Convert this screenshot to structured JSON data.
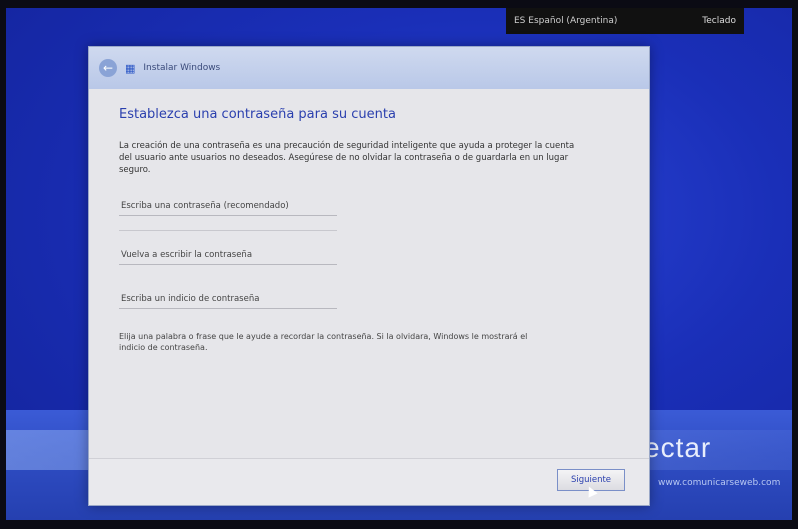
{
  "language_bar": {
    "language": "ES Español (Argentina)",
    "keyboard": "Teclado"
  },
  "background": {
    "text": "ectar",
    "url": "www.comunicarseweb.com"
  },
  "dialog": {
    "title": "Instalar Windows",
    "heading": "Establezca una contraseña para su cuenta",
    "description": "La creación de una contraseña es una precaución de seguridad inteligente que ayuda a proteger la cuenta del usuario ante usuarios no deseados. Asegúrese de no olvidar la contraseña o de guardarla en un lugar seguro.",
    "fields": {
      "password_placeholder": "Escriba una contraseña (recomendado)",
      "confirm_placeholder": "Vuelva a escribir la contraseña",
      "hint_placeholder": "Escriba un indicio de contraseña"
    },
    "hint_text": "Elija una palabra o frase que le ayude a recordar la contraseña. Si la olvidara, Windows le mostrará el indicio de contraseña.",
    "next_label": "Siguiente"
  }
}
